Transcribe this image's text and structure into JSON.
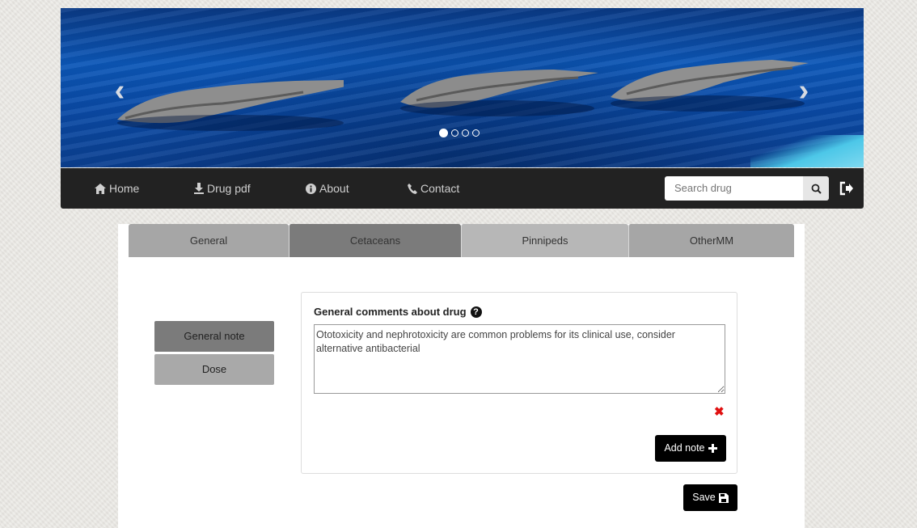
{
  "carousel": {
    "prev_icon": "chevron-left-icon",
    "next_icon": "chevron-right-icon",
    "slides_count": 4,
    "active_slide": 1
  },
  "navbar": {
    "items": [
      {
        "label": "Home",
        "icon": "home-icon"
      },
      {
        "label": "Drug pdf",
        "icon": "download-icon"
      },
      {
        "label": "About",
        "icon": "info-icon"
      },
      {
        "label": "Contact",
        "icon": "phone-icon"
      }
    ],
    "search": {
      "placeholder": "Search drug",
      "value": ""
    },
    "search_icon": "search-icon",
    "logout_icon": "logout-icon"
  },
  "tabs": [
    {
      "label": "General"
    },
    {
      "label": "Cetaceans"
    },
    {
      "label": "Pinnipeds"
    },
    {
      "label": "OtherMM"
    }
  ],
  "active_tab": "Cetaceans",
  "side_menu": [
    {
      "label": "General note"
    },
    {
      "label": "Dose"
    }
  ],
  "note": {
    "label": "General comments about drug",
    "help_icon": "question-circle-icon",
    "text": "Ototoxicity and nephrotoxicity are common problems for its clinical use, consider alternative antibacterial",
    "delete_icon": "x-icon"
  },
  "buttons": {
    "add_note": "Add note",
    "save": "Save"
  },
  "colors": {
    "navbar_bg": "#222222",
    "tab_active": "#7b7b7b",
    "tab_inactive": "#a6a6a6",
    "delete": "#e01010",
    "button_bg": "#000000"
  }
}
